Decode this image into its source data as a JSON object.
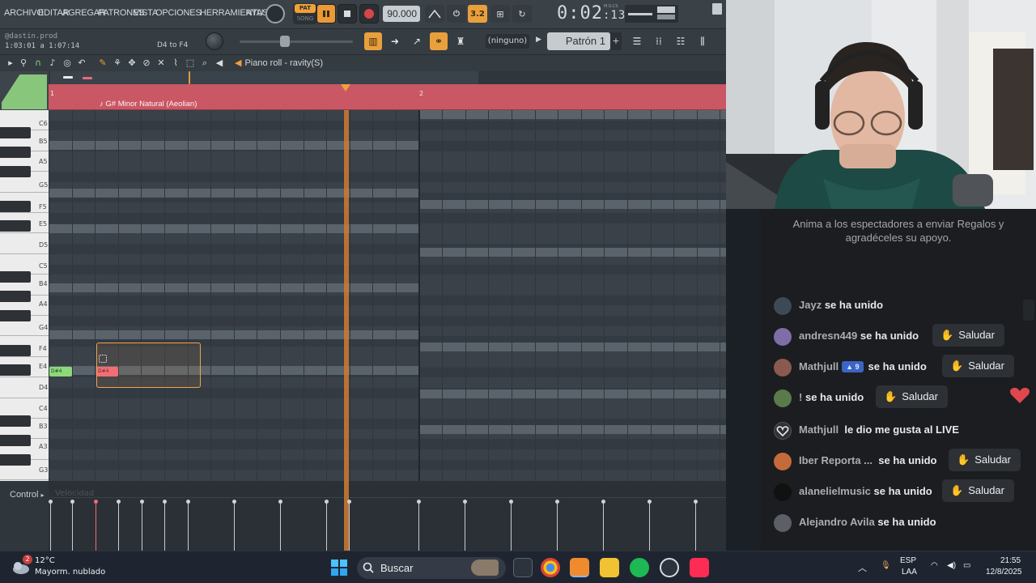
{
  "menu": {
    "items": [
      "ARCHIVO",
      "EDITAR",
      "AGREGAR",
      "PATRONES",
      "VISTA",
      "OPCIONES",
      "HERRAMIENTAS",
      "AYU"
    ]
  },
  "transport": {
    "pat_label": "PAT",
    "song_label": "SONG",
    "tempo": "90.000",
    "time_main": "0:02",
    "time_sub": ":13",
    "time_unit": "M:S:CS",
    "step_label": "3.2"
  },
  "hint_panel": {
    "user": "@dastin.prod",
    "range_time": "1:03:01 a 1:07:14",
    "range_notes": "D4 to F4"
  },
  "toolbar2": {
    "ninguno": "(ninguno)",
    "pattern_name": "Patrón 1",
    "pattern_add": "+"
  },
  "piano_roll": {
    "title": "Piano roll - ravity(S)",
    "scale": "G# Minor Natural (Aeolian)",
    "bar_1": "1",
    "bar_2": "2",
    "key_labels": [
      "C6",
      "B5",
      "A5",
      "G5",
      "F5",
      "E5",
      "D5",
      "C5",
      "B4",
      "A4",
      "G4",
      "F4",
      "E4",
      "D4",
      "C4",
      "B3",
      "A3",
      "G3"
    ],
    "notes": [
      {
        "label": "D#4",
        "color": "#8bd97a"
      },
      {
        "label": "D#4",
        "color": "#f06a78"
      }
    ],
    "control_label": "Control",
    "control_target": "Velocidad"
  },
  "chat": {
    "banner": "Anima a los espectadores a enviar Regalos y agradéceles su apoyo.",
    "saludar_label": "Saludar",
    "messages": [
      {
        "user": "Jayz",
        "text": "se ha unido",
        "avatar_color": "#3d4a55"
      },
      {
        "user": "andresn449",
        "text": "se ha unido",
        "avatar_color": "#7e6ea8"
      },
      {
        "user": "Mathjull",
        "badge": "9",
        "text": "se ha unido",
        "avatar_color": "#8b5a4e"
      },
      {
        "user": "!",
        "text": "se ha unido",
        "avatar_color": "#5a7a4a"
      },
      {
        "user": "Mathjull",
        "text": "le dio me gusta al LIVE",
        "avatar_color": "#2e3135"
      },
      {
        "user": "Iber Reporta ...",
        "text": "se ha unido",
        "avatar_color": "#c56a3a"
      },
      {
        "user": "alanelielmusic",
        "text": "se ha unido",
        "avatar_color": "#111111"
      },
      {
        "user": "Alejandro Avila",
        "text": "se ha unido",
        "avatar_color": "#5c6066"
      }
    ]
  },
  "taskbar": {
    "weather_badge": "2",
    "temp": "12°C",
    "weather": "Mayorm. nublado",
    "search": "Buscar",
    "lang_1": "ESP",
    "lang_2": "LAA",
    "time": "21:55",
    "date": "12/8/2025"
  },
  "colors": {
    "accent_orange": "#f0a13a",
    "timeline_red": "#c95764",
    "note_green": "#8bd97a",
    "note_pink": "#f06a78",
    "heart": "#e0474c"
  }
}
